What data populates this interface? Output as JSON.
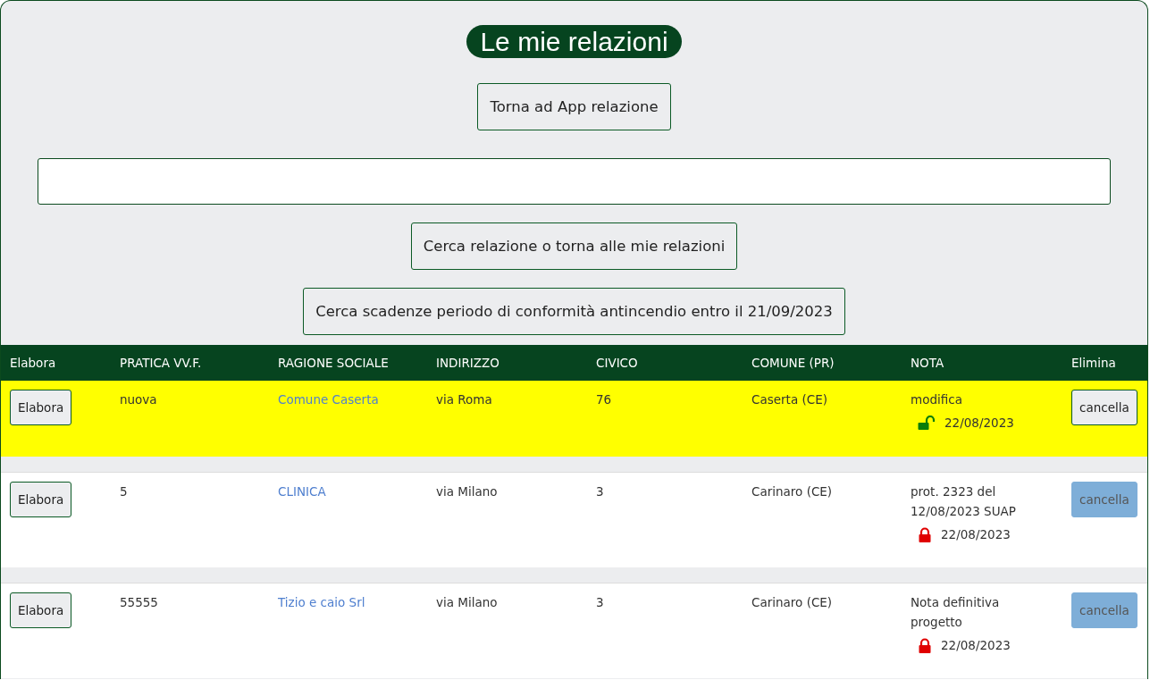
{
  "title": "Le mie relazioni",
  "back_button": "Torna ad App relazione",
  "search_button": "Cerca relazione o torna alle mie relazioni",
  "deadline_button": "Cerca scadenze periodo di conformità antincendio entro il 21/09/2023",
  "table": {
    "columns": [
      "Elabora",
      "PRATICA VV.F.",
      "RAGIONE SOCIALE",
      "INDIRIZZO",
      "CIVICO",
      "COMUNE (PR)",
      "NOTA",
      "Elimina"
    ],
    "rows": [
      {
        "highlighted": true,
        "edit": "Elabora",
        "pratica": "nuova",
        "ragione": "Comune Caserta",
        "indirizzo": "via Roma",
        "civico": "76",
        "comune": "Caserta (CE)",
        "nota": "modifica",
        "locked": false,
        "date": "22/08/2023",
        "delete": "cancella",
        "delete_disabled": false
      },
      {
        "highlighted": false,
        "edit": "Elabora",
        "pratica": "5",
        "ragione": "CLINICA",
        "indirizzo": "via Milano",
        "civico": "3",
        "comune": "Carinaro (CE)",
        "nota": "prot. 2323 del 12/08/2023 SUAP",
        "locked": true,
        "date": "22/08/2023",
        "delete": "cancella",
        "delete_disabled": true
      },
      {
        "highlighted": false,
        "edit": "Elabora",
        "pratica": "55555",
        "ragione": "Tizio e caio Srl",
        "indirizzo": "via Milano",
        "civico": "3",
        "comune": "Carinaro (CE)",
        "nota": "Nota definitiva progetto",
        "locked": true,
        "date": "22/08/2023",
        "delete": "cancella",
        "delete_disabled": true
      }
    ]
  }
}
